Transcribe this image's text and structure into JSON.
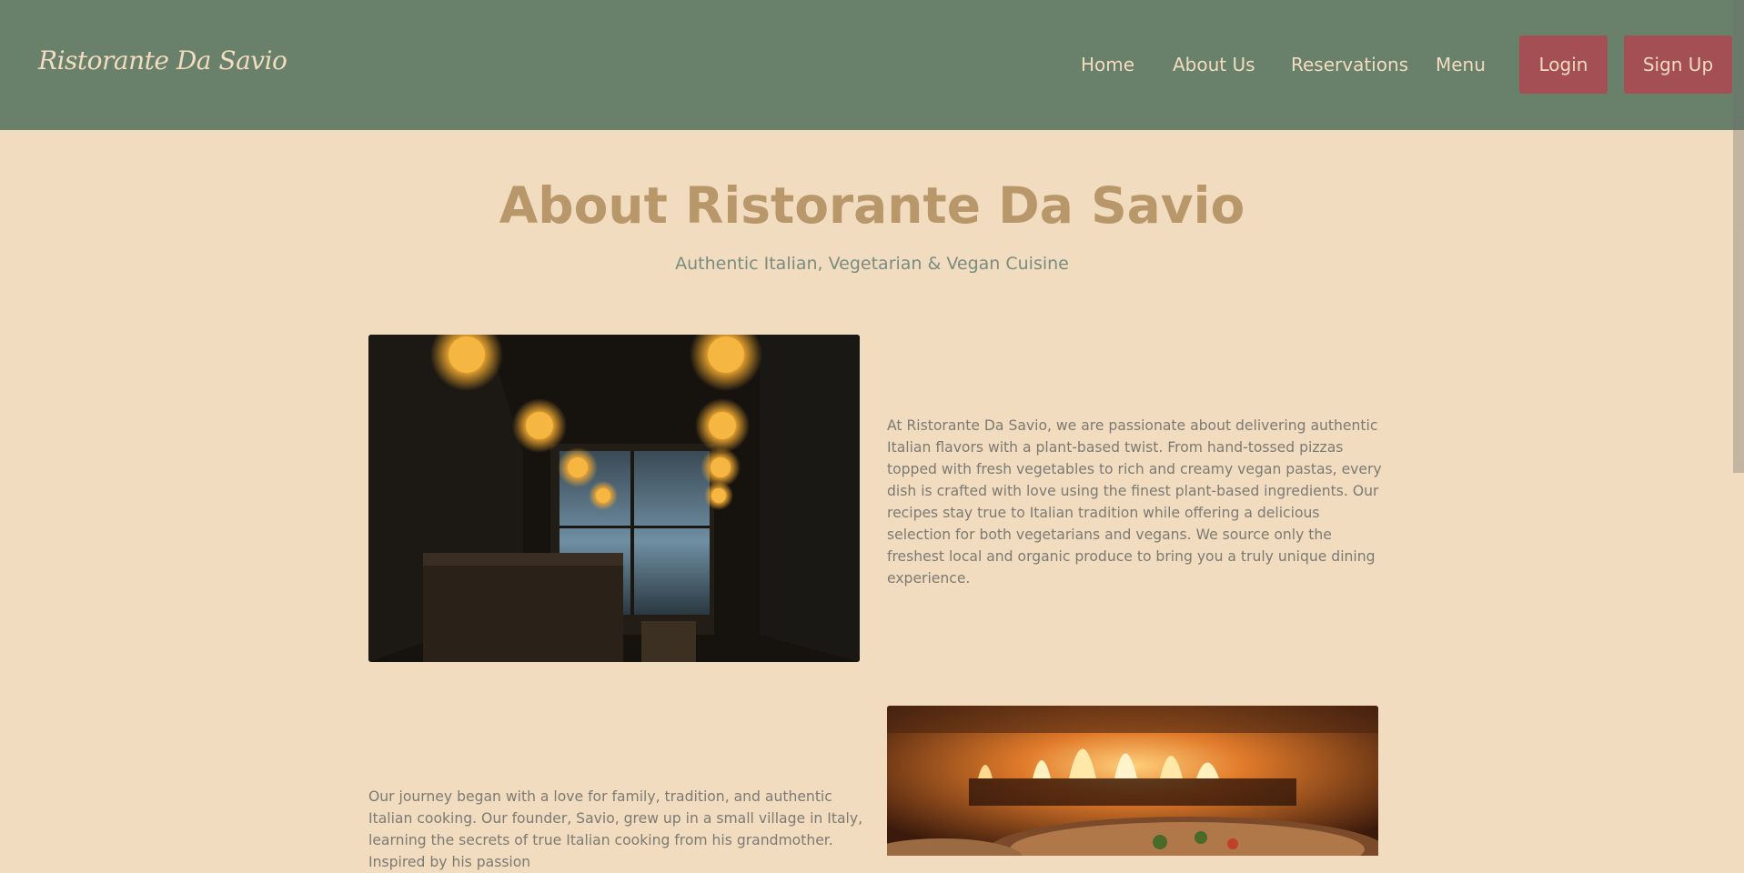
{
  "brand": {
    "name": "Ristorante Da Savio"
  },
  "nav": {
    "links": [
      "Home",
      "About Us",
      "Reservations",
      "Menu"
    ],
    "login_label": "Login",
    "signup_label": "Sign Up"
  },
  "hero": {
    "title": "About Ristorante Da Savio",
    "subtitle": "Authentic Italian, Vegetarian & Vegan Cuisine"
  },
  "sections": [
    {
      "text": "At Ristorante Da Savio, we are passionate about delivering authentic Italian flavors with a plant-based twist. From hand-tossed pizzas topped with fresh vegetables to rich and creamy vegan pastas, every dish is crafted with love using the finest plant-based ingredients. Our recipes stay true to Italian tradition while offering a delicious selection for both vegetarians and vegans. We source only the freshest local and organic produce to bring you a truly unique dining experience."
    },
    {
      "text": "Our journey began with a love for family, tradition, and authentic Italian cooking. Our founder, Savio, grew up in a small village in Italy, learning the secrets of true Italian cooking from his grandmother. Inspired by his passion"
    }
  ],
  "colors": {
    "navbar": "#69806a",
    "background": "#f2dcbf",
    "accent_button": "#a34f53",
    "title": "#b8976a"
  }
}
